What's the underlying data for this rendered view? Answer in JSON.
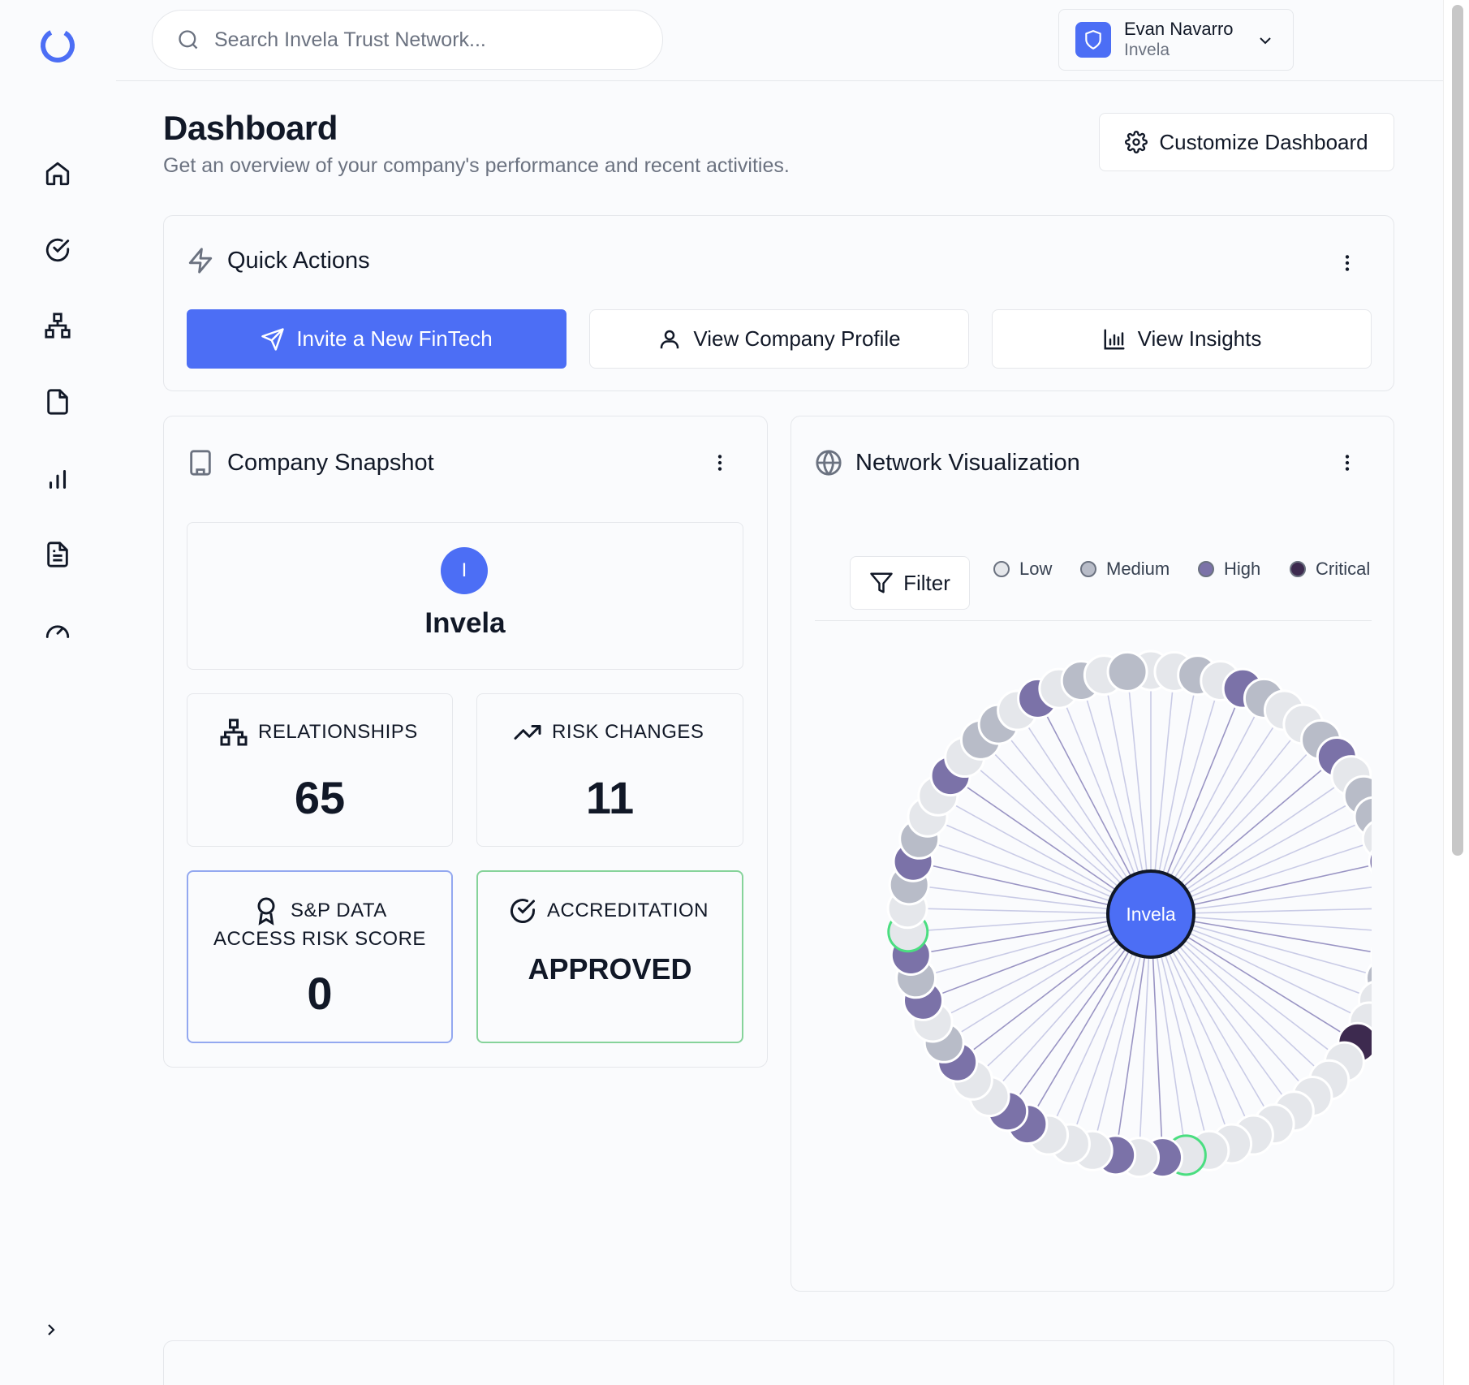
{
  "search": {
    "placeholder": "Search Invela Trust Network..."
  },
  "user": {
    "name": "Evan Navarro",
    "org": "Invela"
  },
  "page": {
    "title": "Dashboard",
    "subtitle": "Get an overview of your company's performance and recent activities.",
    "customize_label": "Customize Dashboard"
  },
  "quick_actions": {
    "title": "Quick Actions",
    "invite_label": "Invite a New FinTech",
    "profile_label": "View Company Profile",
    "insights_label": "View Insights"
  },
  "snapshot": {
    "title": "Company Snapshot",
    "avatar_letter": "I",
    "company": "Invela",
    "relationships_label": "RELATIONSHIPS",
    "relationships_value": "65",
    "risk_changes_label": "RISK CHANGES",
    "risk_changes_value": "11",
    "sp_label_1": "S&P DATA",
    "sp_label_2": "ACCESS RISK SCORE",
    "sp_value": "0",
    "accreditation_label": "ACCREDITATION",
    "accreditation_value": "APPROVED"
  },
  "network": {
    "title": "Network Visualization",
    "filter_label": "Filter",
    "center_label": "Invela",
    "legend": [
      {
        "label": "Low",
        "color": "#e5e7eb"
      },
      {
        "label": "Medium",
        "color": "#b8bcc8"
      },
      {
        "label": "High",
        "color": "#7b72a8"
      },
      {
        "label": "Critical",
        "color": "#3d2a4f"
      }
    ]
  },
  "colors": {
    "accent": "#4c6ef5",
    "accreditation_border": "#86d39a",
    "score_border": "#93a8f0"
  }
}
